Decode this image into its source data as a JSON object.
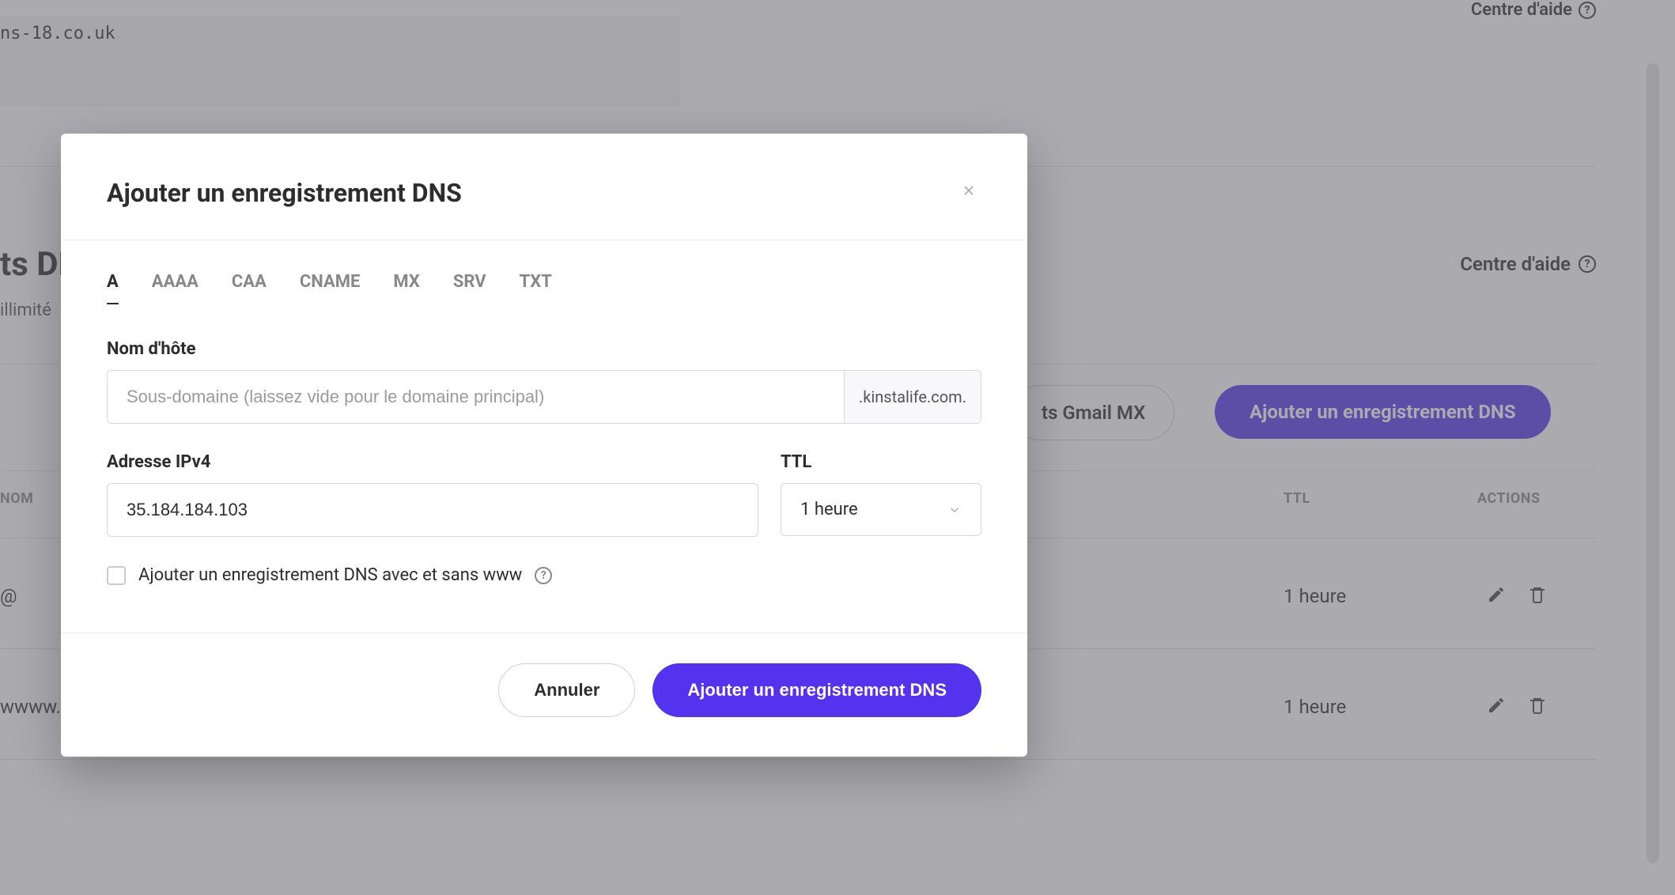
{
  "background": {
    "help_center": "Centre d'aide",
    "code_snippet": "ns-18.co.uk",
    "heading_cut": "ts DN",
    "sub_cut": "illimité",
    "gmail_btn": "ts Gmail MX",
    "add_btn": "Ajouter un enregistrement DNS",
    "table": {
      "th_nom": "NOM",
      "th_ttl": "TTL",
      "th_actions": "ACTIONS",
      "rows": [
        {
          "nom": "@",
          "ttl": "1 heure"
        },
        {
          "nom": "wwww.",
          "ttl": "1 heure"
        }
      ]
    }
  },
  "modal": {
    "title": "Ajouter un enregistrement DNS",
    "tabs": [
      "A",
      "AAAA",
      "CAA",
      "CNAME",
      "MX",
      "SRV",
      "TXT"
    ],
    "active_tab": "A",
    "hostname_label": "Nom d'hôte",
    "hostname_placeholder": "Sous-domaine (laissez vide pour le domaine principal)",
    "hostname_suffix": ".kinstalife.com.",
    "ip_label": "Adresse IPv4",
    "ip_value": "35.184.184.103",
    "ttl_label": "TTL",
    "ttl_value": "1 heure",
    "checkbox_label": "Ajouter un enregistrement DNS avec et sans www",
    "cancel": "Annuler",
    "submit": "Ajouter un enregistrement DNS"
  }
}
